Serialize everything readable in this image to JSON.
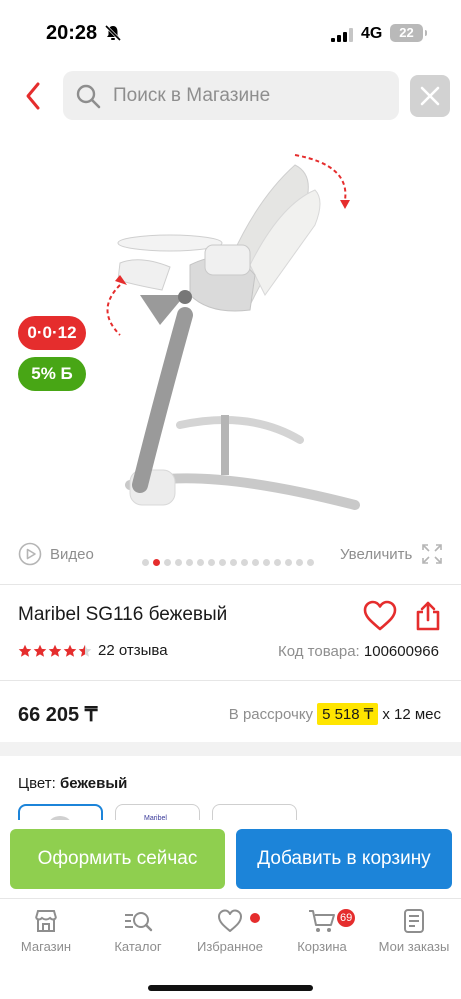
{
  "status_bar": {
    "time": "20:28",
    "network": "4G",
    "battery": "22"
  },
  "search": {
    "placeholder": "Поиск в Магазине"
  },
  "badges": {
    "installment": "0·0·12",
    "bonus": "5% Б"
  },
  "gallery": {
    "video_label": "Видео",
    "zoom_label": "Увеличить",
    "dots_total": 16,
    "dot_active_index": 1
  },
  "product": {
    "title": "Maribel SG116 бежевый",
    "reviews": "22 отзыва",
    "rating": 4.5,
    "sku_label": "Код товара:",
    "sku_value": "100600966",
    "price": "66 205 ₸",
    "installment_label": "В рассрочку",
    "installment_amount": "5 518 ₸",
    "installment_term": "х 12 мес"
  },
  "color": {
    "label": "Цвет:",
    "value": "бежевый",
    "swatch_text": "Maribel"
  },
  "actions": {
    "buy_now": "Оформить сейчас",
    "add_to_cart": "Добавить в корзину"
  },
  "tabs": [
    {
      "label": "Магазин"
    },
    {
      "label": "Каталог"
    },
    {
      "label": "Избранное"
    },
    {
      "label": "Корзина",
      "badge": "69"
    },
    {
      "label": "Мои заказы"
    }
  ],
  "colors": {
    "accent_red": "#e52d2d",
    "green": "#48a615",
    "buy_green": "#8fcf4f",
    "cart_blue": "#1c84d9",
    "highlight_yellow": "#ffe500"
  }
}
